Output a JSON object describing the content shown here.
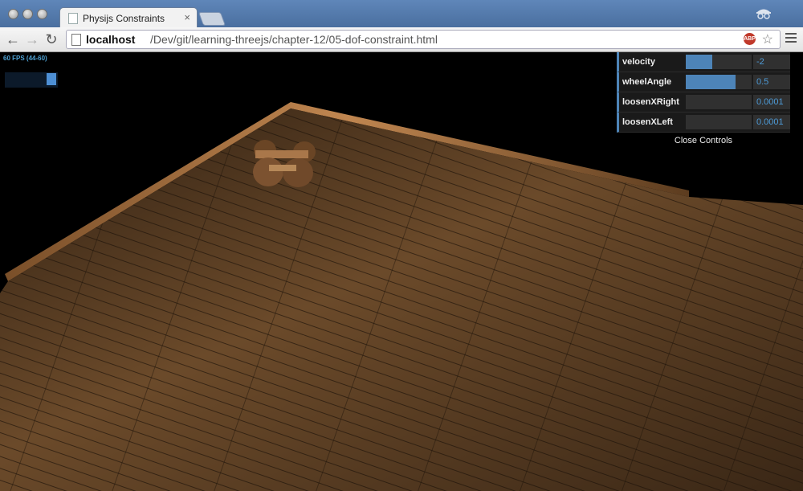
{
  "browser": {
    "tab_title": "Physijs Constraints",
    "tab_close": "×",
    "url_host": "localhost",
    "url_path": "/Dev/git/learning-threejs/chapter-12/05-dof-constraint.html",
    "abp_label": "ABP",
    "back_label": "←",
    "forward_label": "→",
    "reload_label": "↻",
    "star_label": "☆"
  },
  "stats": {
    "fps_text": "60 FPS (44-60)"
  },
  "controls": {
    "rows": [
      {
        "label": "velocity",
        "value": "-2",
        "fill": 0.4
      },
      {
        "label": "wheelAngle",
        "value": "0.5",
        "fill": 0.75
      },
      {
        "label": "loosenXRight",
        "value": "0.0001",
        "fill": 0
      },
      {
        "label": "loosenXLeft",
        "value": "0.0001",
        "fill": 0
      }
    ],
    "close_label": "Close Controls"
  },
  "colors": {
    "accent": "#4d84b8",
    "value_text": "#4d9ad6",
    "floor": "#5c3e22",
    "wall": "#a06d3a"
  }
}
